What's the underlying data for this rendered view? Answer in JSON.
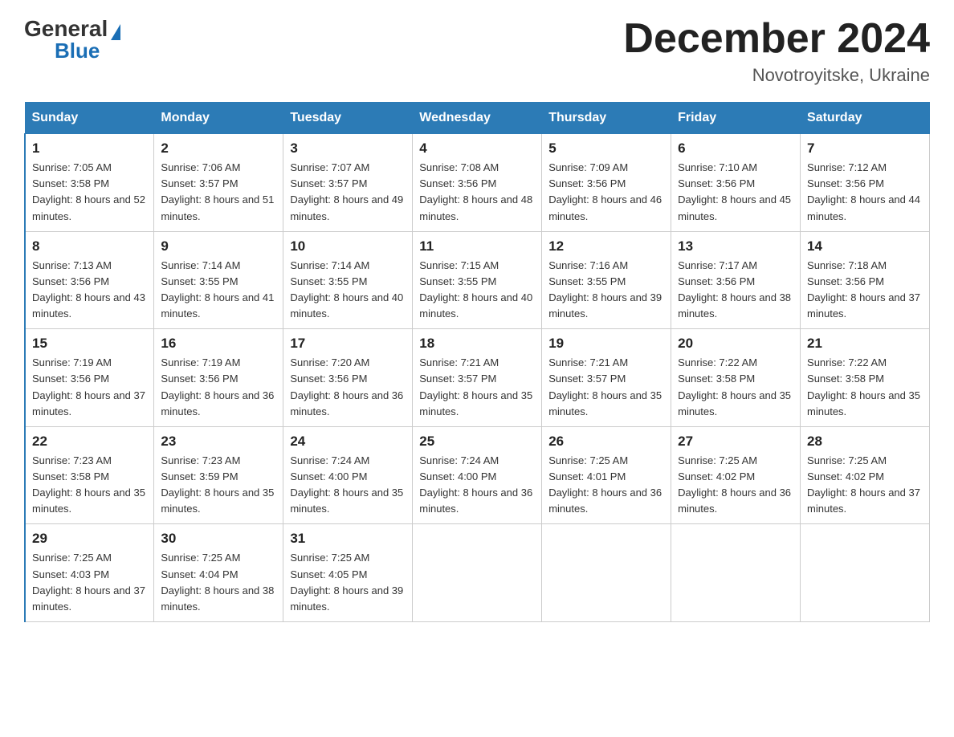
{
  "logo": {
    "general": "General",
    "blue": "Blue",
    "triangle": "▼"
  },
  "title": "December 2024",
  "location": "Novotroyitske, Ukraine",
  "days_of_week": [
    "Sunday",
    "Monday",
    "Tuesday",
    "Wednesday",
    "Thursday",
    "Friday",
    "Saturday"
  ],
  "weeks": [
    [
      {
        "day": "1",
        "sunrise": "7:05 AM",
        "sunset": "3:58 PM",
        "daylight": "8 hours and 52 minutes."
      },
      {
        "day": "2",
        "sunrise": "7:06 AM",
        "sunset": "3:57 PM",
        "daylight": "8 hours and 51 minutes."
      },
      {
        "day": "3",
        "sunrise": "7:07 AM",
        "sunset": "3:57 PM",
        "daylight": "8 hours and 49 minutes."
      },
      {
        "day": "4",
        "sunrise": "7:08 AM",
        "sunset": "3:56 PM",
        "daylight": "8 hours and 48 minutes."
      },
      {
        "day": "5",
        "sunrise": "7:09 AM",
        "sunset": "3:56 PM",
        "daylight": "8 hours and 46 minutes."
      },
      {
        "day": "6",
        "sunrise": "7:10 AM",
        "sunset": "3:56 PM",
        "daylight": "8 hours and 45 minutes."
      },
      {
        "day": "7",
        "sunrise": "7:12 AM",
        "sunset": "3:56 PM",
        "daylight": "8 hours and 44 minutes."
      }
    ],
    [
      {
        "day": "8",
        "sunrise": "7:13 AM",
        "sunset": "3:56 PM",
        "daylight": "8 hours and 43 minutes."
      },
      {
        "day": "9",
        "sunrise": "7:14 AM",
        "sunset": "3:55 PM",
        "daylight": "8 hours and 41 minutes."
      },
      {
        "day": "10",
        "sunrise": "7:14 AM",
        "sunset": "3:55 PM",
        "daylight": "8 hours and 40 minutes."
      },
      {
        "day": "11",
        "sunrise": "7:15 AM",
        "sunset": "3:55 PM",
        "daylight": "8 hours and 40 minutes."
      },
      {
        "day": "12",
        "sunrise": "7:16 AM",
        "sunset": "3:55 PM",
        "daylight": "8 hours and 39 minutes."
      },
      {
        "day": "13",
        "sunrise": "7:17 AM",
        "sunset": "3:56 PM",
        "daylight": "8 hours and 38 minutes."
      },
      {
        "day": "14",
        "sunrise": "7:18 AM",
        "sunset": "3:56 PM",
        "daylight": "8 hours and 37 minutes."
      }
    ],
    [
      {
        "day": "15",
        "sunrise": "7:19 AM",
        "sunset": "3:56 PM",
        "daylight": "8 hours and 37 minutes."
      },
      {
        "day": "16",
        "sunrise": "7:19 AM",
        "sunset": "3:56 PM",
        "daylight": "8 hours and 36 minutes."
      },
      {
        "day": "17",
        "sunrise": "7:20 AM",
        "sunset": "3:56 PM",
        "daylight": "8 hours and 36 minutes."
      },
      {
        "day": "18",
        "sunrise": "7:21 AM",
        "sunset": "3:57 PM",
        "daylight": "8 hours and 35 minutes."
      },
      {
        "day": "19",
        "sunrise": "7:21 AM",
        "sunset": "3:57 PM",
        "daylight": "8 hours and 35 minutes."
      },
      {
        "day": "20",
        "sunrise": "7:22 AM",
        "sunset": "3:58 PM",
        "daylight": "8 hours and 35 minutes."
      },
      {
        "day": "21",
        "sunrise": "7:22 AM",
        "sunset": "3:58 PM",
        "daylight": "8 hours and 35 minutes."
      }
    ],
    [
      {
        "day": "22",
        "sunrise": "7:23 AM",
        "sunset": "3:58 PM",
        "daylight": "8 hours and 35 minutes."
      },
      {
        "day": "23",
        "sunrise": "7:23 AM",
        "sunset": "3:59 PM",
        "daylight": "8 hours and 35 minutes."
      },
      {
        "day": "24",
        "sunrise": "7:24 AM",
        "sunset": "4:00 PM",
        "daylight": "8 hours and 35 minutes."
      },
      {
        "day": "25",
        "sunrise": "7:24 AM",
        "sunset": "4:00 PM",
        "daylight": "8 hours and 36 minutes."
      },
      {
        "day": "26",
        "sunrise": "7:25 AM",
        "sunset": "4:01 PM",
        "daylight": "8 hours and 36 minutes."
      },
      {
        "day": "27",
        "sunrise": "7:25 AM",
        "sunset": "4:02 PM",
        "daylight": "8 hours and 36 minutes."
      },
      {
        "day": "28",
        "sunrise": "7:25 AM",
        "sunset": "4:02 PM",
        "daylight": "8 hours and 37 minutes."
      }
    ],
    [
      {
        "day": "29",
        "sunrise": "7:25 AM",
        "sunset": "4:03 PM",
        "daylight": "8 hours and 37 minutes."
      },
      {
        "day": "30",
        "sunrise": "7:25 AM",
        "sunset": "4:04 PM",
        "daylight": "8 hours and 38 minutes."
      },
      {
        "day": "31",
        "sunrise": "7:25 AM",
        "sunset": "4:05 PM",
        "daylight": "8 hours and 39 minutes."
      },
      null,
      null,
      null,
      null
    ]
  ]
}
